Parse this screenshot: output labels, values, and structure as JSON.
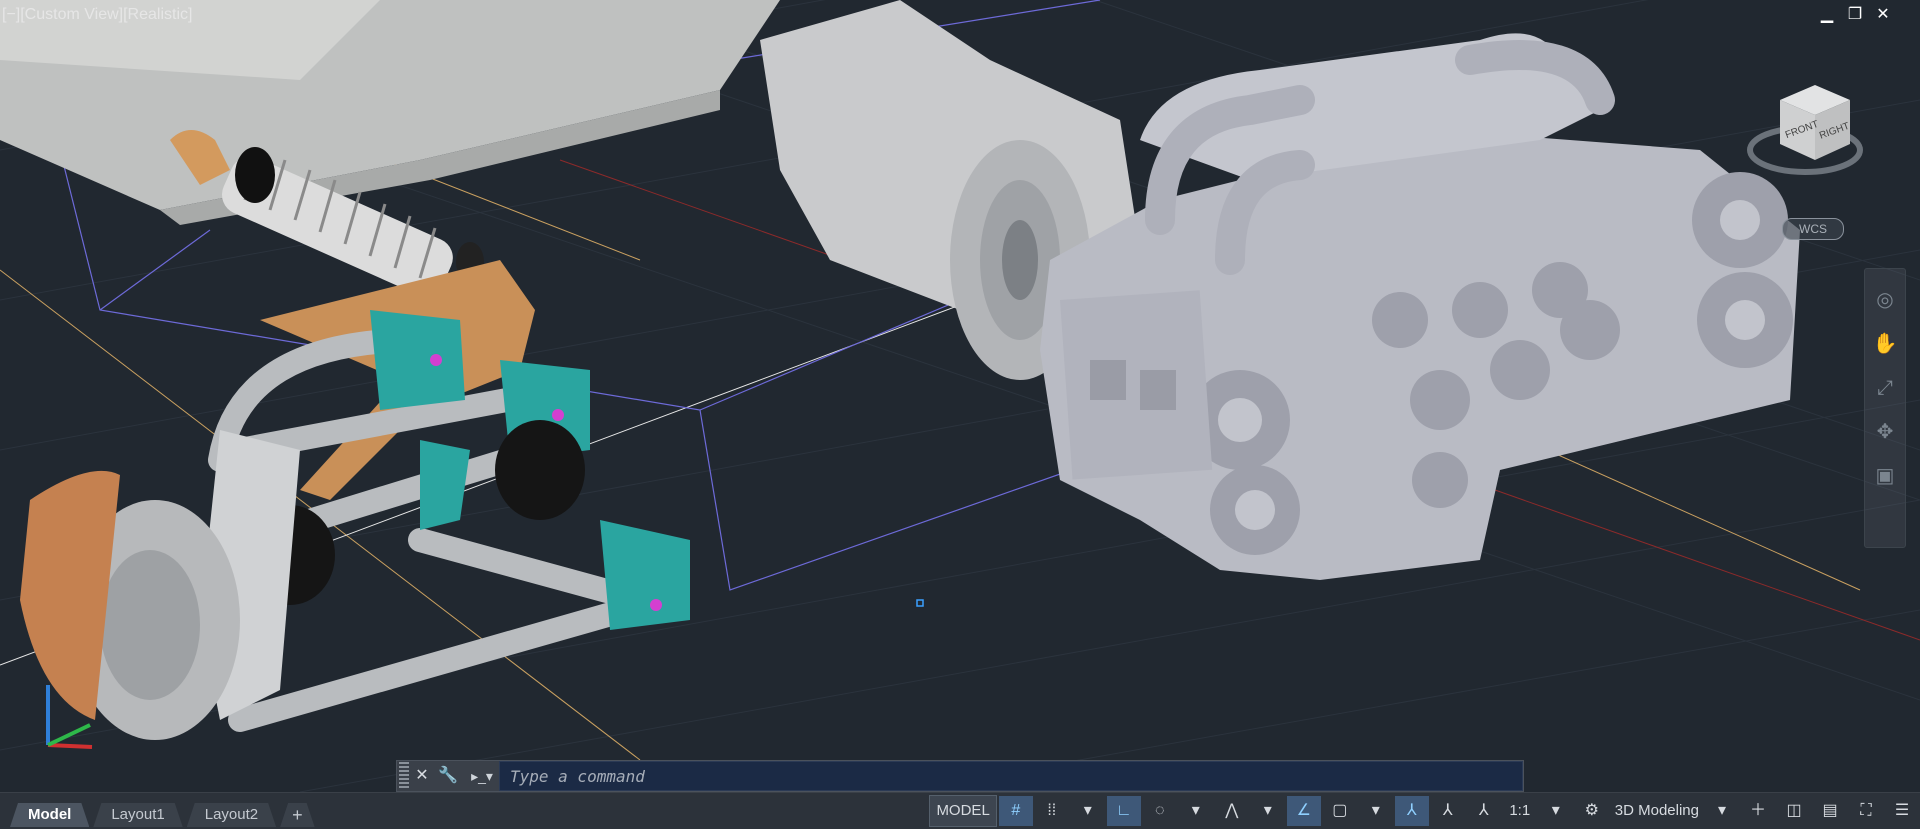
{
  "viewport": {
    "view_label": {
      "minus": "[−]",
      "view": "[Custom View]",
      "style": "[Realistic]"
    },
    "window_controls": [
      "▁",
      "❐",
      "✕"
    ],
    "viewcube": {
      "front": "FRONT",
      "right": "RIGHT"
    },
    "wcs_label": "WCS"
  },
  "command_line": {
    "placeholder": "Type a command",
    "close_icon": "✕",
    "settings_icon": "🔧"
  },
  "layout_tabs": [
    {
      "label": "Model",
      "active": true
    },
    {
      "label": "Layout1",
      "active": false
    },
    {
      "label": "Layout2",
      "active": false
    },
    {
      "label": "+",
      "active": false
    }
  ],
  "status_bar": {
    "model": "MODEL",
    "scale": "1:1",
    "workspace": "3D Modeling"
  },
  "icons": {
    "grid": "grid-icon",
    "snap": "snap-icon",
    "ortho": "ortho-icon",
    "polar": "polar-icon",
    "osnap": "osnap-icon",
    "annotation": "annotation-icon",
    "gear": "gear-icon",
    "plus": "plus-icon",
    "fullscreen": "fullscreen-icon",
    "menu": "menu-icon"
  },
  "colors": {
    "background": "#212830",
    "accent": "#8fd0ff"
  }
}
